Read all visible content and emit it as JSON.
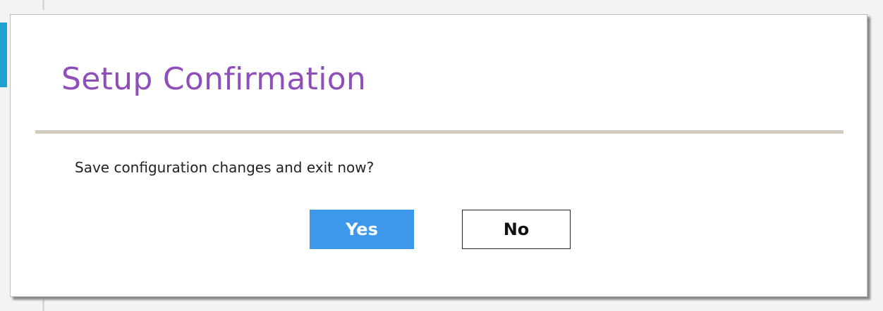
{
  "dialog": {
    "title": "Setup Confirmation",
    "message": "Save configuration changes and exit now?",
    "buttons": {
      "yes_label": "Yes",
      "no_label": "No"
    }
  },
  "colors": {
    "title": "#8e4fba",
    "divider": "#d2c9bf",
    "primary_button": "#3d98ec",
    "accent": "#1fa0d2"
  }
}
